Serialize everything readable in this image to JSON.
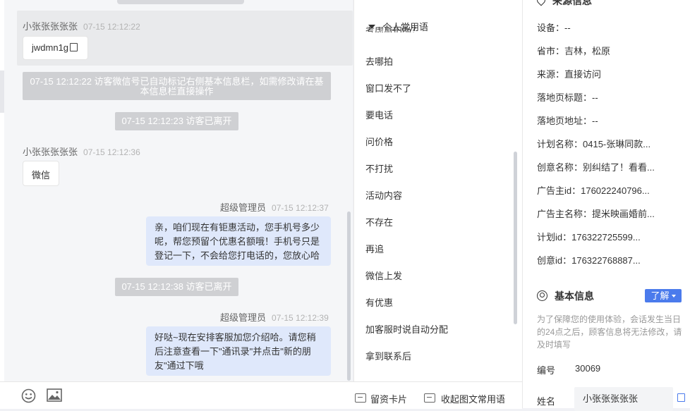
{
  "chat": {
    "messages": [
      {
        "name": "小张张张张张",
        "time": "07-15 12:12:22",
        "text": "jwdmn1g"
      },
      {
        "system": "07-15 12:12:22 访客微信号已自动标记右侧基本信息栏，如需修改请在基本信息栏直接操作"
      },
      {
        "system": "07-15 12:12:23 访客已离开"
      },
      {
        "name": "小张张张张张",
        "time": "07-15 12:12:36",
        "text": "微信"
      },
      {
        "name": "超级管理员",
        "time": "07-15 12:12:37",
        "text_lines": [
          "亲，咱们现在有钜惠活动，您手机号多少",
          "呢，帮您预留个优惠名额哦！手机号只是",
          "登记一下，不会给您打电话的，您放心哈"
        ]
      },
      {
        "system": "07-15 12:12:38 访客已离开"
      },
      {
        "name": "超级管理员",
        "time": "07-15 12:12:39",
        "text_lines": [
          "好哒~现在安排客服加您介绍哈。请您稍",
          "后注意查看一下\"通讯录\"并点击\"新的朋",
          "友\"通过下哦"
        ]
      }
    ]
  },
  "toolbar": {
    "emoji_icon": "emoji-icon",
    "image_icon": "image-icon",
    "card_label": "留资卡片",
    "collapse_label": "收起图文常用语"
  },
  "phrases": {
    "header": "个人常用语",
    "cut_item": "考虑旅拍吗？",
    "items": [
      "去哪拍",
      "窗口发不了",
      "要电话",
      "问价格",
      "不打扰",
      "活动内容",
      "不存在",
      "再追",
      "微信上发",
      "有优惠",
      "加客服时说自动分配",
      "拿到联系后"
    ]
  },
  "source": {
    "title": "来源信息",
    "rows": [
      "设备：--",
      "省市：吉林，松原",
      "来源：直接访问",
      "落地页标题：--",
      "落地页地址：--",
      "计划名称：0415-张琳同款...",
      "创意名称：别纠结了！看看...",
      "广告主id：176022240796...",
      "广告主名称：提米映画婚前...",
      "计划id：176322725599...",
      "创意id：176322768887..."
    ]
  },
  "basic": {
    "title": "基本信息",
    "learn_label": "了解",
    "notice": "为了保障您的使用体验，会话发生当日的24点之后，顾客信息将无法修改，请及时填写",
    "id_label": "编号",
    "id_value": "30069",
    "name_label": "姓名",
    "name_value": "小张张张张张"
  }
}
